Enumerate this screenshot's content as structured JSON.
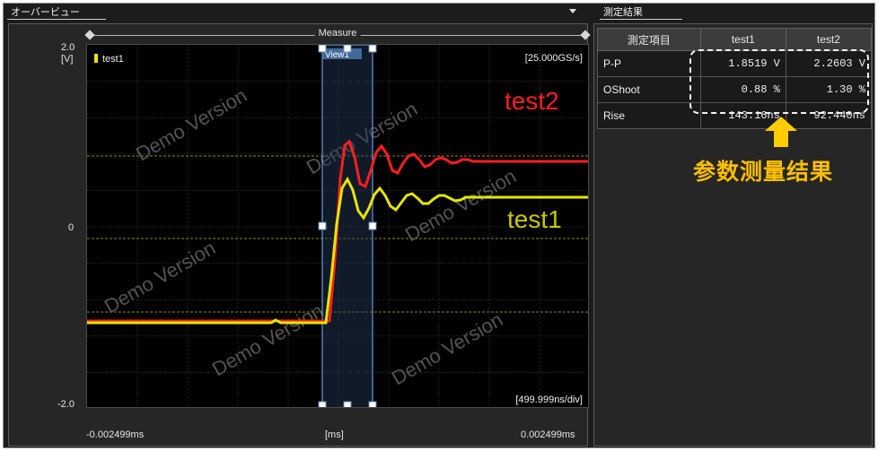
{
  "tabs": {
    "overview": "オーバービュー",
    "results": "測定結果"
  },
  "measure_label": "Measure",
  "plot": {
    "y_top": "2.0",
    "y_unit": "[V]",
    "y_zero": "0",
    "y_bottom": "-2.0",
    "x_left": "-0.002499ms",
    "x_center": "[ms]",
    "x_right": "0.002499ms",
    "sample_rate": "[25.000GS/s]",
    "timebase": "[499.999ns/div]",
    "legend": "test1",
    "view_label": "View1",
    "watermark": "Demo Version",
    "trace_label_test2": "test2",
    "trace_label_test1": "test1",
    "colors": {
      "test1": "#e6e600",
      "test2": "#ff1e1e",
      "cursor": "#7ab4ff"
    }
  },
  "results": {
    "headers": [
      "測定項目",
      "test1",
      "test2"
    ],
    "rows": [
      {
        "name": "P-P",
        "test1": "1.8519 V",
        "test2": "2.2603 V"
      },
      {
        "name": "OShoot",
        "test1": "0.88 %",
        "test2": "1.30 %"
      },
      {
        "name": "Rise",
        "test1": "143.16ns",
        "test2": "92.440ns"
      }
    ]
  },
  "annotation": "参数测量结果",
  "icons": {
    "dropdown": "triangle-down-icon",
    "pointer": "arrow-up-icon"
  }
}
